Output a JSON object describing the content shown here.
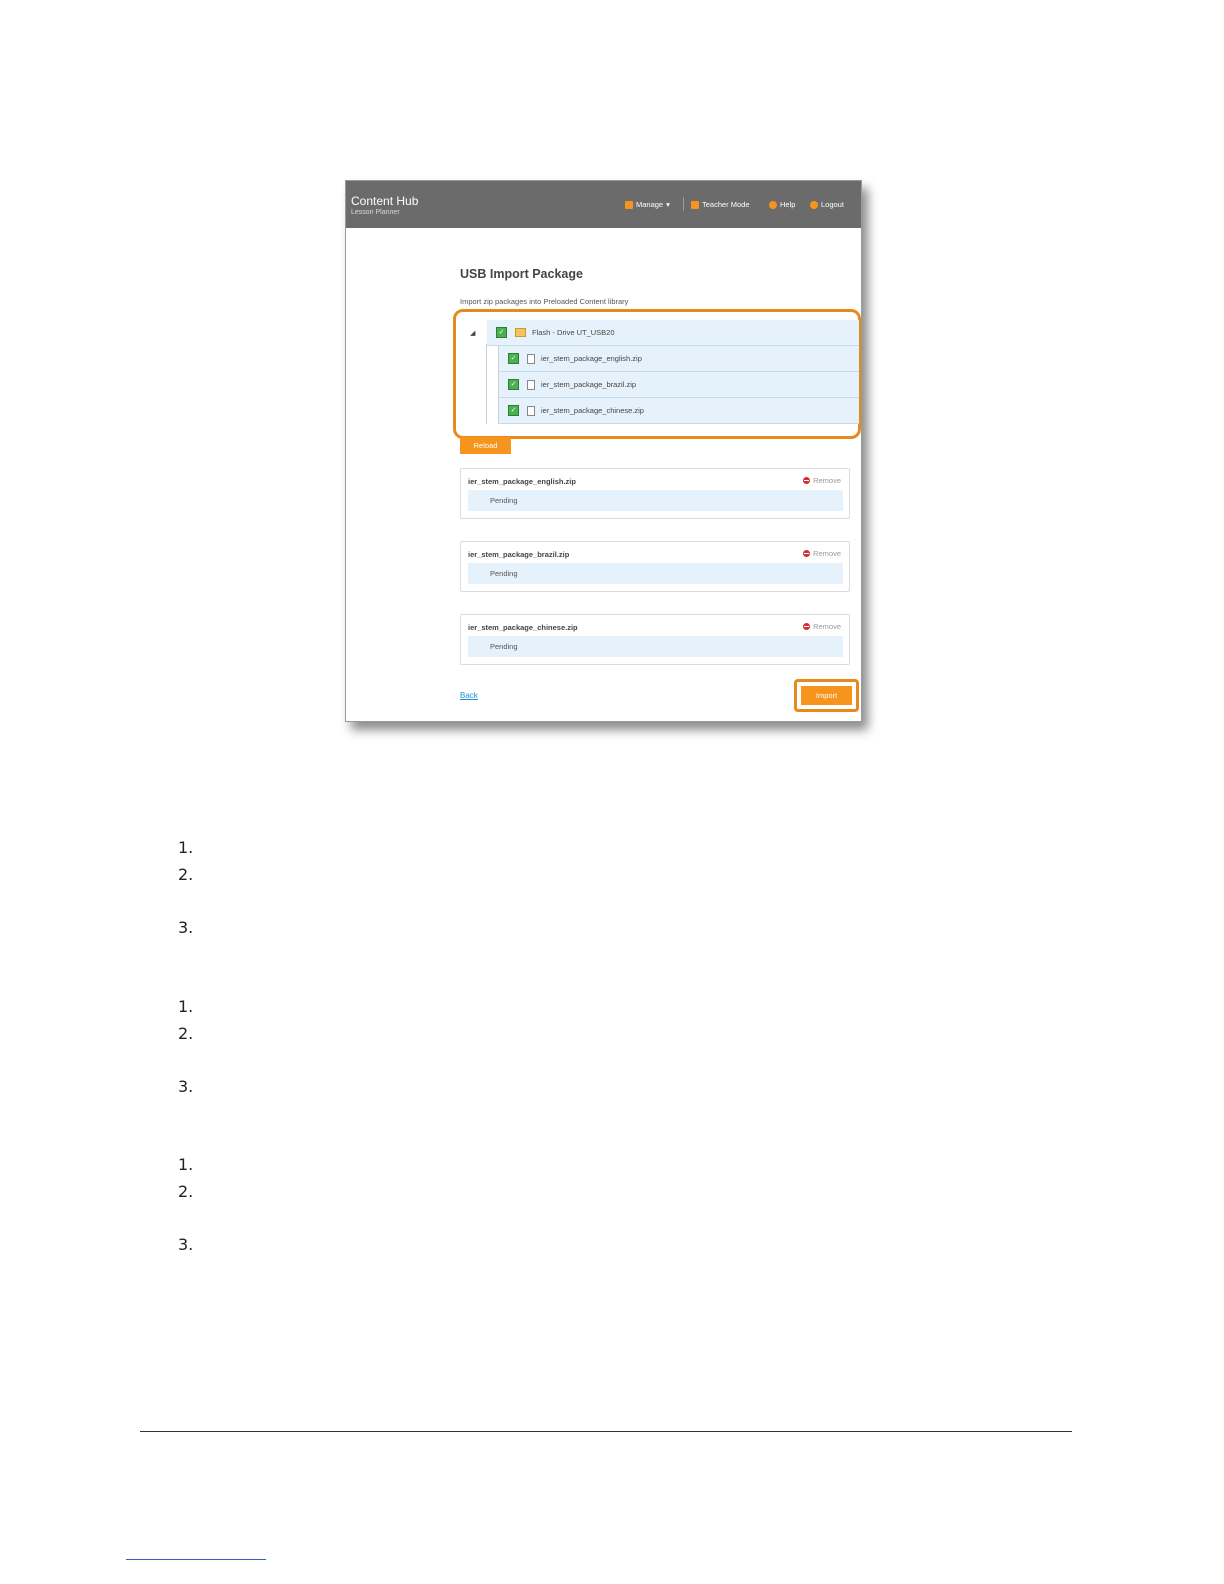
{
  "app": {
    "title": "Content Hub",
    "subtitle": "Lesson Planner",
    "nav": {
      "manage": "Manage",
      "teacher_mode": "Teacher Mode",
      "help": "Help",
      "logout": "Logout"
    }
  },
  "page": {
    "title": "USB Import Package",
    "description": "Import zip packages into Preloaded Content library"
  },
  "tree": {
    "root": {
      "label": "Flash - Drive UT_USB20",
      "checked": true
    },
    "files": [
      {
        "label": "ier_stem_package_english.zip",
        "checked": true
      },
      {
        "label": "ier_stem_package_brazil.zip",
        "checked": true
      },
      {
        "label": "ier_stem_package_chinese.zip",
        "checked": true
      }
    ]
  },
  "buttons": {
    "reload": "Reload",
    "import": "Import",
    "back": "Back"
  },
  "packages": [
    {
      "name": "ier_stem_package_english.zip",
      "remove": "Remove",
      "status": "Pending"
    },
    {
      "name": "ier_stem_package_brazil.zip",
      "remove": "Remove",
      "status": "Pending"
    },
    {
      "name": "ier_stem_package_chinese.zip",
      "remove": "Remove",
      "status": "Pending"
    }
  ],
  "steps": [
    {
      "number": "1."
    },
    {
      "number": "2."
    },
    {
      "number": "3."
    },
    {
      "number": "1."
    },
    {
      "number": "2."
    },
    {
      "number": "3."
    },
    {
      "number": "1."
    },
    {
      "number": "2."
    },
    {
      "number": "3."
    }
  ],
  "colors": {
    "accent": "#f7941d",
    "highlight": "#e8891c",
    "header": "#6b6b6b",
    "row": "#e6f2fb"
  }
}
